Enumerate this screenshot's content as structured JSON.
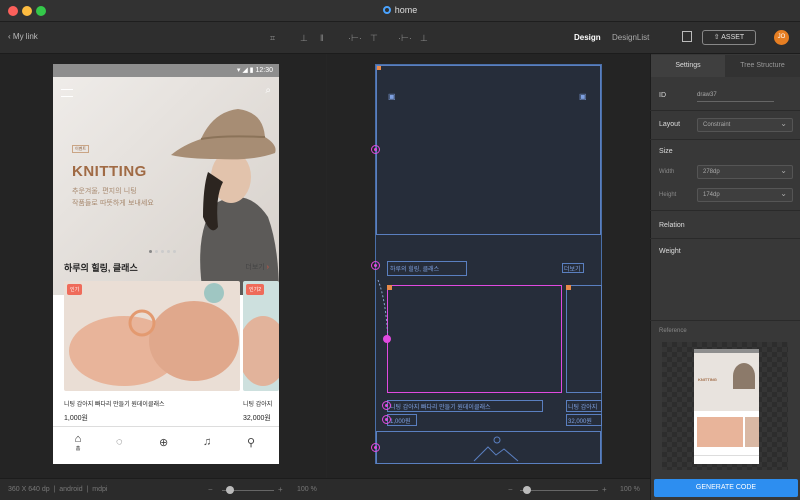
{
  "window": {
    "title": "home"
  },
  "toolbar": {
    "back_label": "My link",
    "design_tab": "Design",
    "designlist_tab": "DesignList",
    "asset_label": "ASSET",
    "avatar": "JO"
  },
  "phone": {
    "status_time": "12:30",
    "hero_small_label": "이벤트",
    "hero_title": "KNITTING",
    "hero_subtitle_1": "추운겨울, 편지의 니팅",
    "hero_subtitle_2": "작품들로 따뜻하게 보내세요",
    "section_title": "하루의 힐링, 클래스",
    "more_label": "더보기",
    "cards": [
      {
        "tag": "인기",
        "title": "니팅 감아지 빠다리 만들기 원데이클래스",
        "price": "1,000원"
      },
      {
        "tag": "인기2",
        "title": "니팅 감아지",
        "price": "32,000원"
      }
    ],
    "tab_home_label": "홈"
  },
  "blueprint": {
    "section_text": "하루의 힐링, 클래스",
    "more_text": "더보기",
    "card_title_1": "니팅 감아지 빠다리 만들기 원데이클래스",
    "card_title_2": "니팅 감아지",
    "price_1": "1,000원",
    "price_2": "32,000원"
  },
  "panel": {
    "tabs": [
      "Settings",
      "Tree Structure"
    ],
    "id_label": "ID",
    "id_value": "draw37",
    "layout_label": "Layout",
    "layout_value": "Constraint",
    "size_label": "Size",
    "width_label": "Width",
    "width_value": "278dp",
    "height_label": "Height",
    "height_value": "174dp",
    "relation_label": "Relation",
    "weight_label": "Weight",
    "reference_label": "Reference",
    "generate_label": "GENERATE CODE"
  },
  "status": {
    "dims": "360 X 640 dp",
    "platform": "android",
    "density": "mdpi",
    "zoom_left": "100 %",
    "zoom_right": "100 %"
  }
}
